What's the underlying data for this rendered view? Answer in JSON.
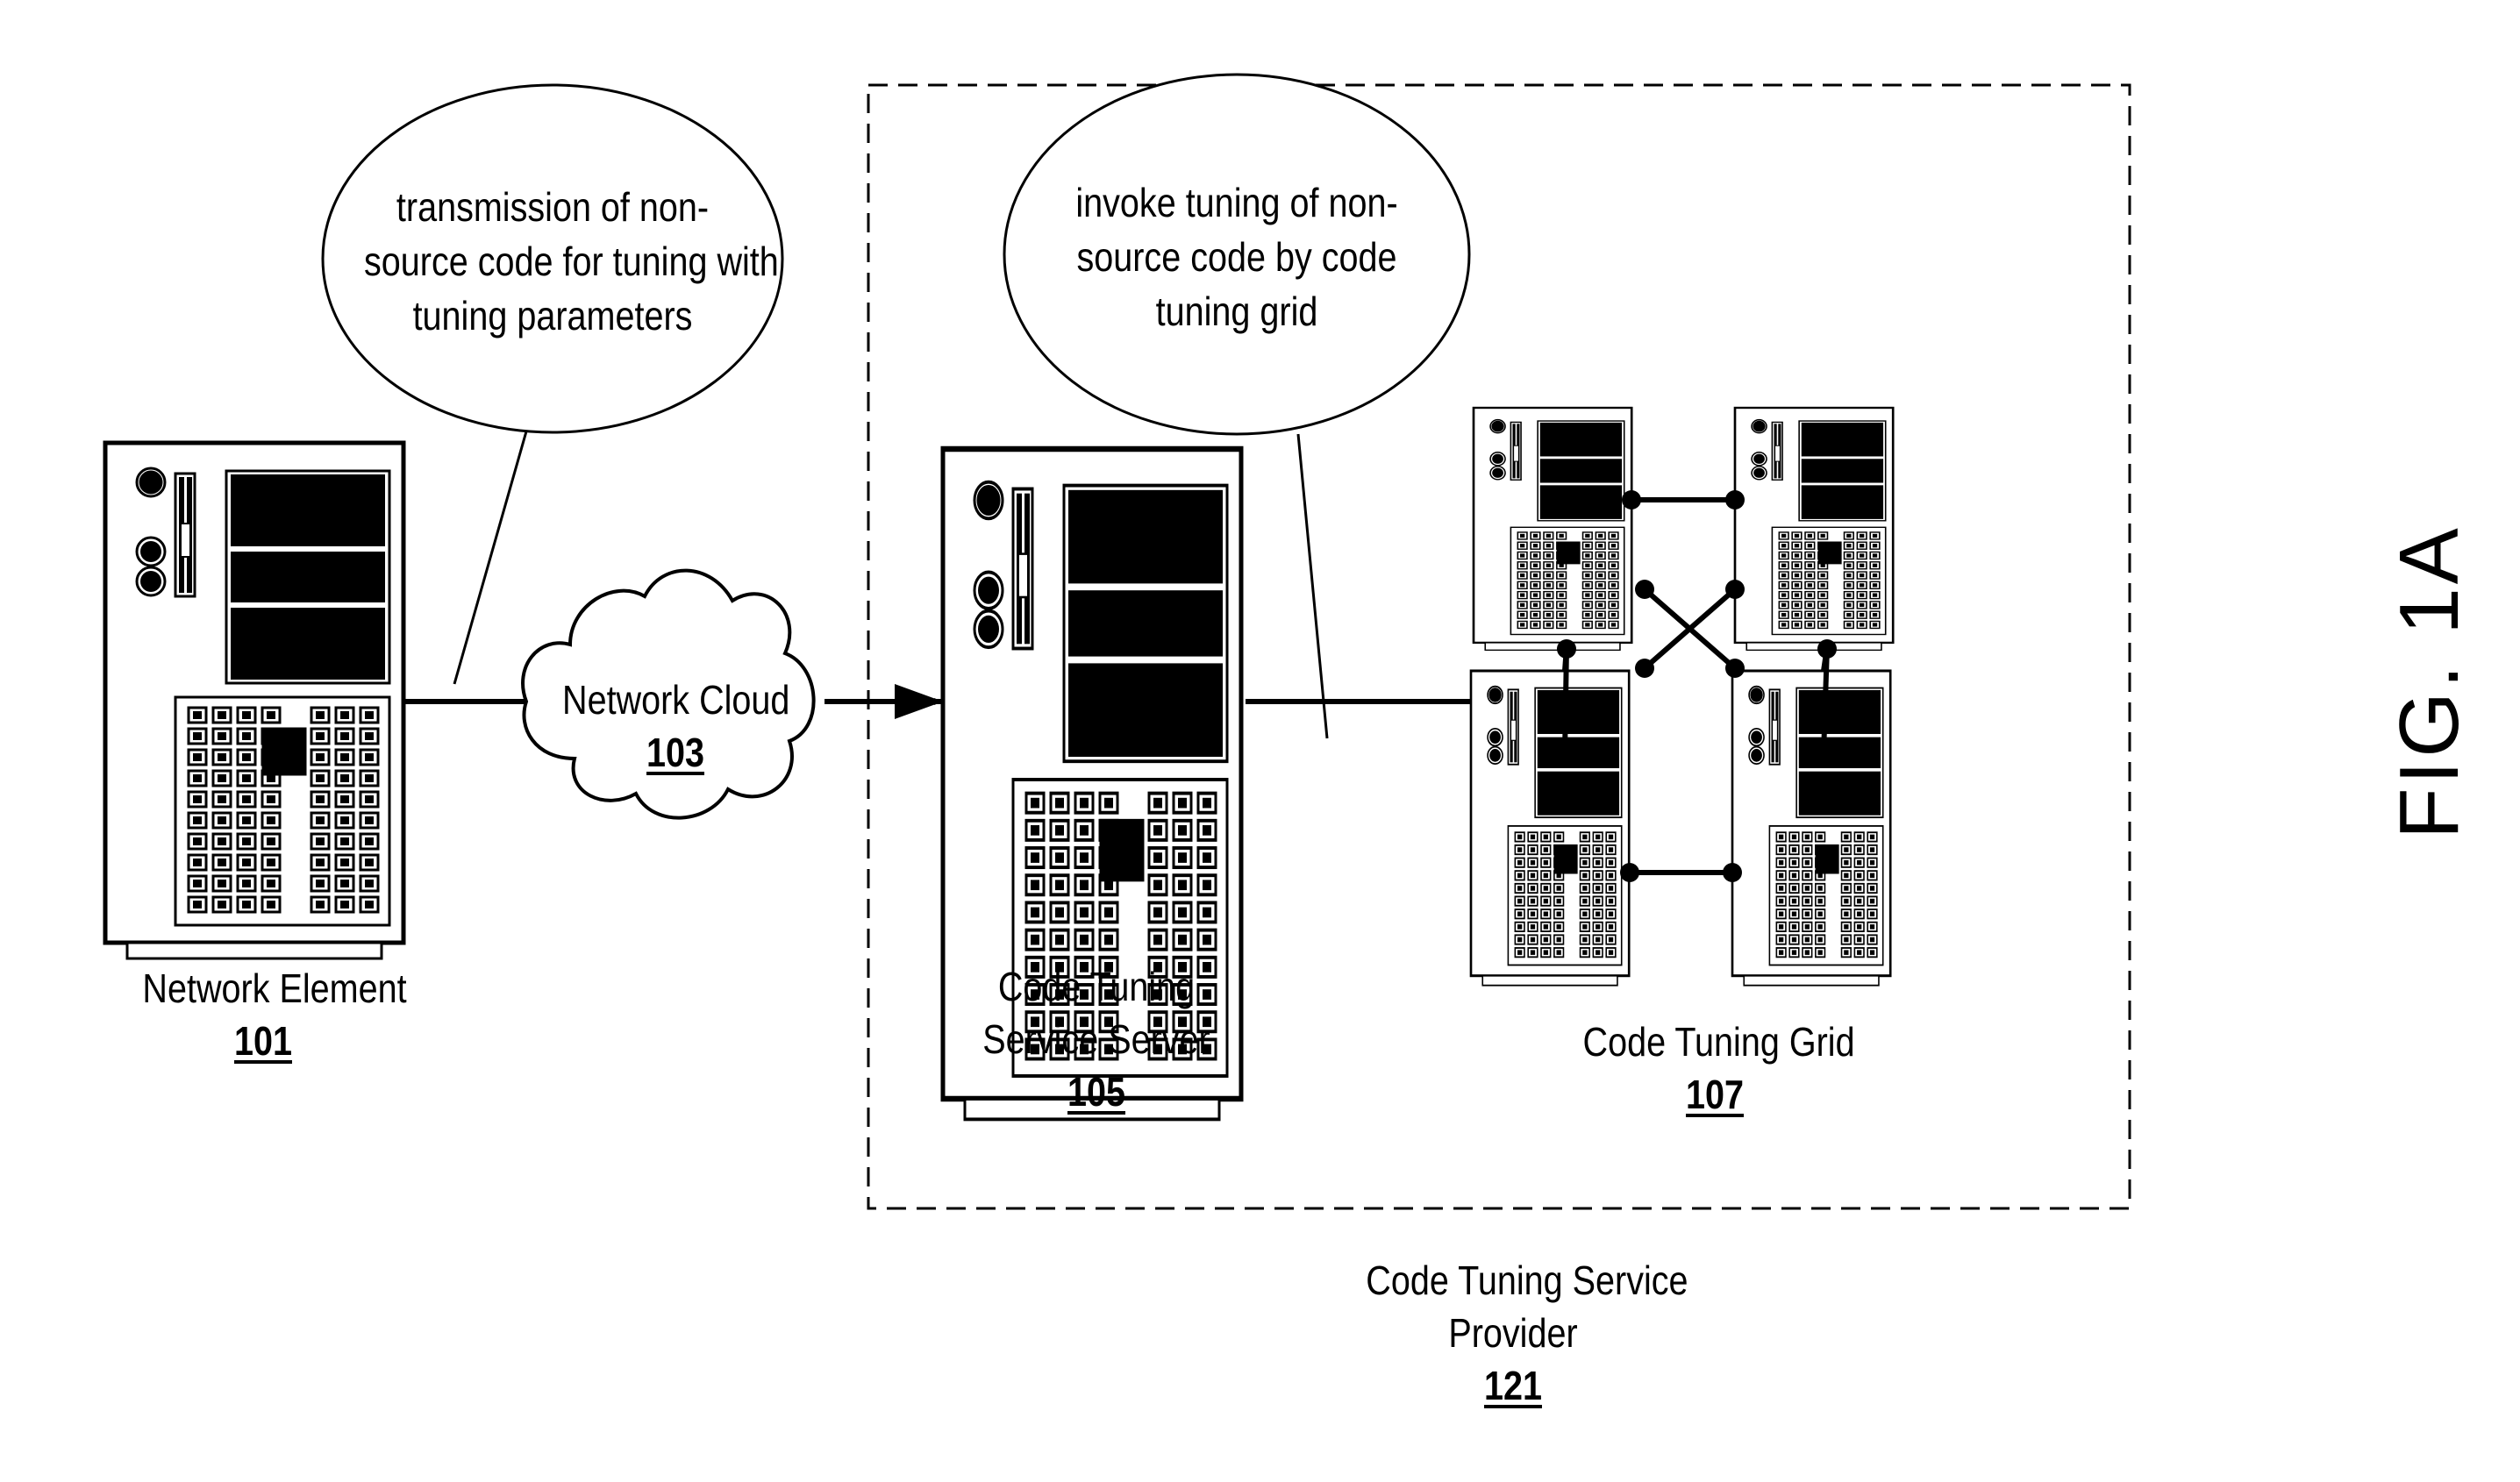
{
  "figure": {
    "label": "FIG. 1A"
  },
  "nodes": {
    "network_element": {
      "name": "Network Element",
      "ref": "101"
    },
    "network_cloud": {
      "name": "Network Cloud",
      "ref": "103"
    },
    "code_tuning_server": {
      "name_line1": "Code Tuning",
      "name_line2": "Service Server",
      "ref": "105"
    },
    "code_tuning_grid": {
      "name": "Code Tuning Grid",
      "ref": "107"
    },
    "service_provider": {
      "name_line1": "Code Tuning Service",
      "name_line2": "Provider",
      "ref": "121"
    }
  },
  "callouts": {
    "transmission": {
      "lines": [
        "transmission of non-",
        "source code for tuning with",
        "tuning parameters"
      ]
    },
    "invoke": {
      "lines": [
        "invoke tuning of non-",
        "source code by code",
        "tuning grid"
      ]
    }
  },
  "grid": {
    "server_count": 4,
    "links": [
      "top-left—top-right",
      "bottom-left—bottom-right",
      "top-left—bottom-left",
      "top-right—bottom-right",
      "top-left—bottom-right",
      "top-right—bottom-left"
    ]
  }
}
